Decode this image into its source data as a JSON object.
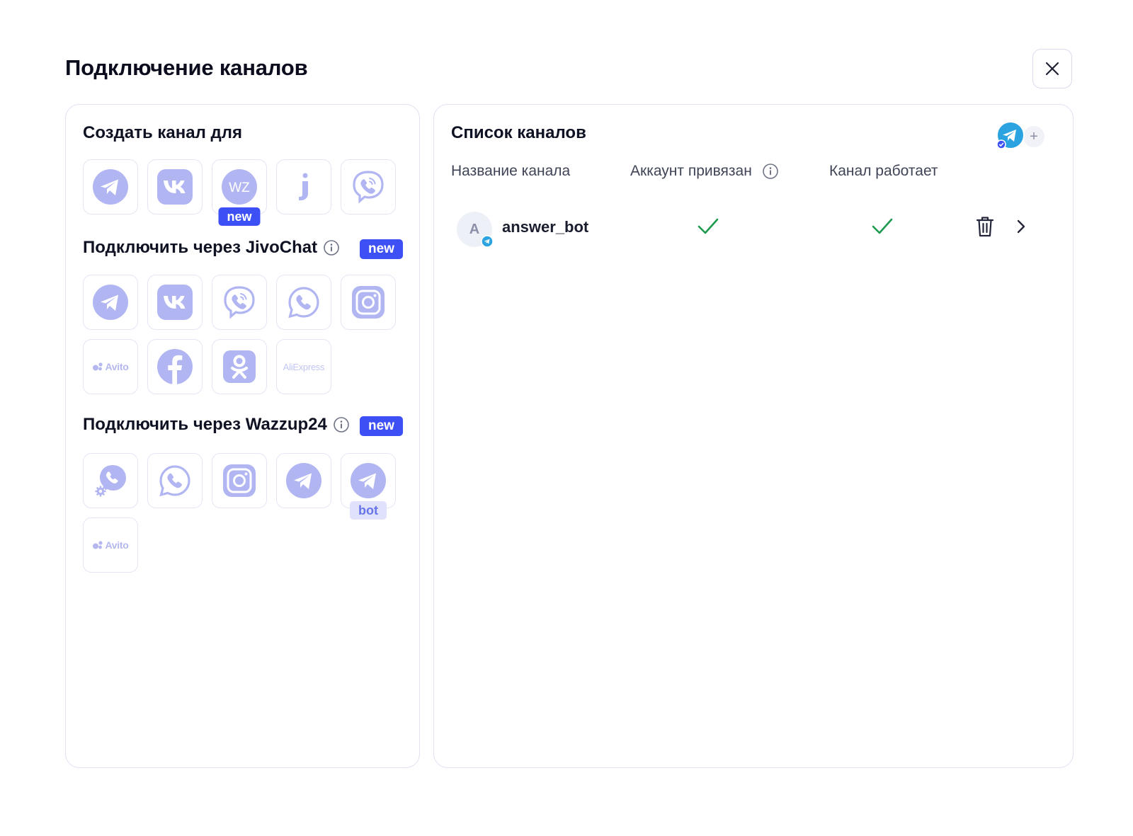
{
  "header": {
    "title": "Подключение каналов",
    "close_icon": "close-icon"
  },
  "left": {
    "create_section": {
      "title": "Создать канал для",
      "tiles": [
        {
          "icon": "telegram-icon"
        },
        {
          "icon": "vk-icon"
        },
        {
          "icon": "wazzup-icon",
          "label": "WZ",
          "badge": "new"
        },
        {
          "icon": "jivo-icon"
        },
        {
          "icon": "viber-icon"
        }
      ]
    },
    "jivochat_section": {
      "title": "Подключить через JivoChat",
      "badge": "new",
      "tiles": [
        {
          "icon": "telegram-icon"
        },
        {
          "icon": "vk-icon"
        },
        {
          "icon": "viber-icon"
        },
        {
          "icon": "whatsapp-icon"
        },
        {
          "icon": "instagram-icon"
        },
        {
          "icon": "avito-icon",
          "label": "Avito"
        },
        {
          "icon": "facebook-icon"
        },
        {
          "icon": "odnoklassniki-icon"
        },
        {
          "icon": "aliexpress-icon",
          "label": "AliExpress"
        }
      ]
    },
    "wazzup_section": {
      "title": "Подключить через Wazzup24",
      "badge": "new",
      "tiles": [
        {
          "icon": "phone-settings-icon"
        },
        {
          "icon": "whatsapp-icon"
        },
        {
          "icon": "instagram-icon"
        },
        {
          "icon": "telegram-icon"
        },
        {
          "icon": "telegram-bot-icon",
          "badge": "bot"
        },
        {
          "icon": "avito-icon",
          "label": "Avito"
        }
      ]
    }
  },
  "right": {
    "title": "Список каналов",
    "add_button": "+",
    "columns": {
      "name": "Название канала",
      "account": "Аккаунт привязан",
      "working": "Канал работает"
    },
    "rows": [
      {
        "avatar_letter": "A",
        "name": "answer_bot",
        "account_linked": true,
        "working": true
      }
    ]
  },
  "colors": {
    "accent": "#3d50f5",
    "icon_fill": "#b1b6f2",
    "check": "#1e9a4f",
    "telegram": "#2aa3e0"
  }
}
